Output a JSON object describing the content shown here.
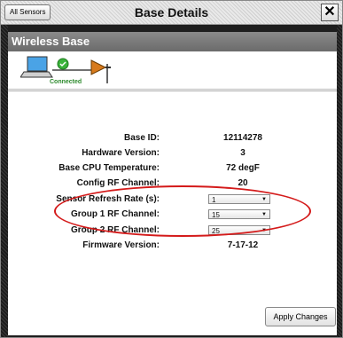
{
  "header": {
    "all_sensors_label": "All Sensors",
    "title": "Base Details",
    "close_symbol": "✕"
  },
  "section": {
    "title": "Wireless Base"
  },
  "status": {
    "text": "Connected",
    "icons": [
      "laptop-icon",
      "connected-check-icon",
      "wireless-base-icon"
    ]
  },
  "details": {
    "base_id_label": "Base ID:",
    "base_id_value": "12114278",
    "hardware_label": "Hardware Version:",
    "hardware_value": "3",
    "cpu_temp_label": "Base CPU Temperature:",
    "cpu_temp_value": "72 degF",
    "config_rf_label": "Config RF Channel:",
    "config_rf_value": "20",
    "refresh_label": "Sensor Refresh Rate (s):",
    "refresh_value": "1",
    "group1_label": "Group 1 RF Channel:",
    "group1_value": "15",
    "group2_label": "Group 2 RF Channel:",
    "group2_value": "25",
    "firmware_label": "Firmware Version:",
    "firmware_value": "7-17-12"
  },
  "actions": {
    "apply_label": "Apply Changes"
  },
  "colors": {
    "connected": "#2e8b2e",
    "highlight": "#d41a1a",
    "header_bg": "#6b6b6b"
  }
}
